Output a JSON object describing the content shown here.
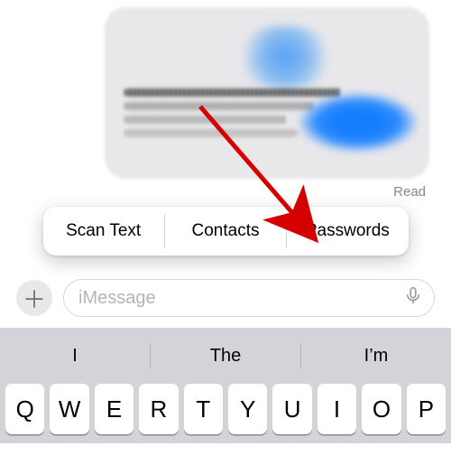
{
  "bubble": {
    "status": "Read"
  },
  "context_menu": {
    "items": [
      "Scan Text",
      "Contacts",
      "Passwords"
    ]
  },
  "input": {
    "plus_glyph": "＋",
    "placeholder": "iMessage"
  },
  "keyboard": {
    "predictions": [
      "I",
      "The",
      "I’m"
    ],
    "row1": [
      "Q",
      "W",
      "E",
      "R",
      "T",
      "Y",
      "U",
      "I",
      "O",
      "P"
    ]
  }
}
